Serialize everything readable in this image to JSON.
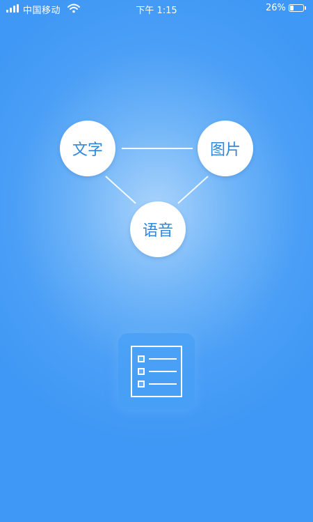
{
  "status_bar": {
    "carrier": "中国移动",
    "time": "下午 1:15",
    "battery_percent_text": "26%",
    "battery_level": 0.26,
    "icons": [
      "signal-bars-icon",
      "wifi-icon",
      "battery-icon"
    ]
  },
  "diagram": {
    "nodes": {
      "text": "文字",
      "image": "图片",
      "voice": "语音"
    }
  },
  "main_icon": "list-icon",
  "colors": {
    "background": "#3f98f5",
    "background_glow": "#a9d3fb",
    "node_fill": "#ffffff",
    "node_text": "#2e86de"
  }
}
